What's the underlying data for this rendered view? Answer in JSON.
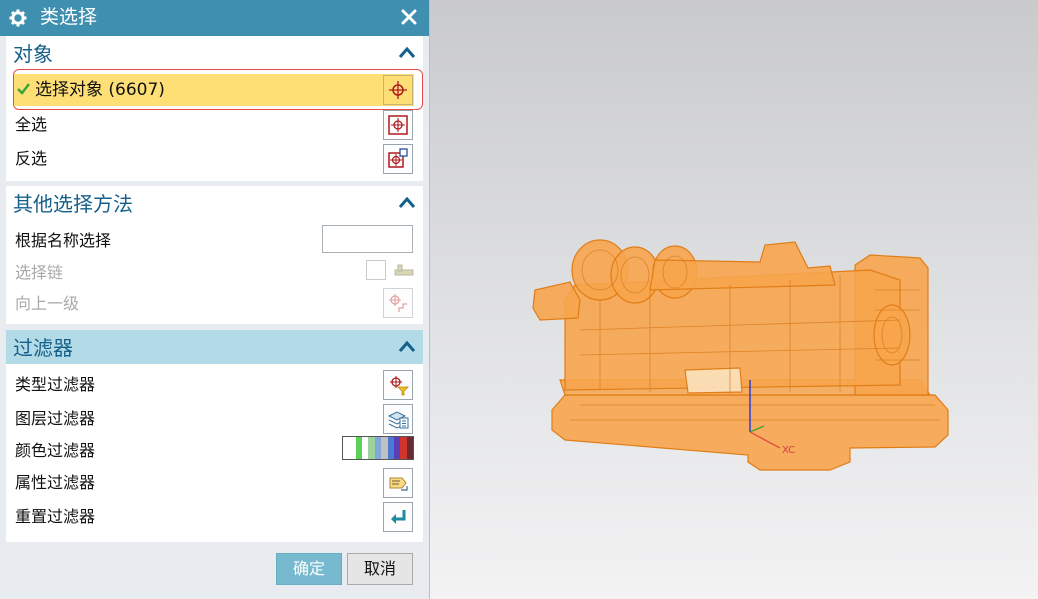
{
  "dialog": {
    "title": "类选择",
    "sections": {
      "object": {
        "title": "对象",
        "select_object": "选择对象 (6607)",
        "select_all": "全选",
        "invert_selection": "反选"
      },
      "other_methods": {
        "title": "其他选择方法",
        "select_by_name": "根据名称选择",
        "select_by_name_value": "",
        "select_chain": "选择链",
        "up_one_level": "向上一级"
      },
      "filters": {
        "title": "过滤器",
        "type_filter": "类型过滤器",
        "layer_filter": "图层过滤器",
        "color_filter": "颜色过滤器",
        "attribute_filter": "属性过滤器",
        "reset_filter": "重置过滤器"
      }
    },
    "buttons": {
      "ok": "确定",
      "cancel": "取消"
    }
  },
  "viewport": {
    "axis_label": "XC",
    "model_color": "#f7a54c"
  },
  "colors": {
    "title_bar": "#3e8fb0",
    "section_text": "#15608a",
    "selected_row": "#fddf76",
    "highlight_outline": "#e84a4a",
    "filter_header": "#b3dbe7"
  },
  "icons": {
    "title": "gear-icon",
    "close": "close-icon",
    "collapse": "chevron-up-icon",
    "select_object": "crosshair-icon",
    "select_all": "select-all-icon",
    "invert_selection": "invert-selection-icon",
    "select_chain": "chain-icon",
    "up_one_level": "up-level-icon",
    "type_filter": "type-filter-icon",
    "layer_filter": "layer-filter-icon",
    "attribute_filter": "attribute-filter-icon",
    "reset_filter": "reset-arrow-icon"
  }
}
